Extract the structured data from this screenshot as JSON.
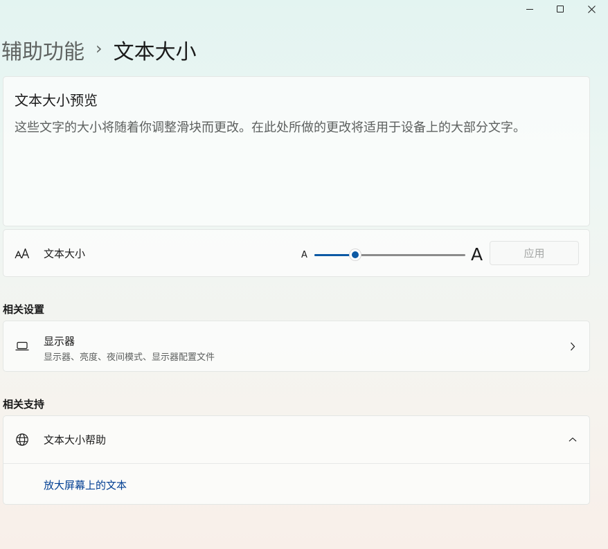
{
  "breadcrumb": {
    "parent": "辅助功能",
    "separator": "›",
    "current": "文本大小"
  },
  "preview": {
    "title": "文本大小预览",
    "body": "这些文字的大小将随着你调整滑块而更改。在此处所做的更改将适用于设备上的大部分文字。"
  },
  "text_size": {
    "icon": "text-size-icon",
    "label": "文本大小",
    "small_marker": "A",
    "large_marker": "A",
    "slider_fraction": 0.27,
    "apply_label": "应用",
    "accent_color": "#0c59a4"
  },
  "related_settings": {
    "heading": "相关设置",
    "display": {
      "icon": "laptop-icon",
      "title": "显示器",
      "subtitle": "显示器、亮度、夜间模式、显示器配置文件"
    }
  },
  "related_support": {
    "heading": "相关支持",
    "help": {
      "icon": "globe-icon",
      "title": "文本大小帮助",
      "expanded": true,
      "link_label": "放大屏幕上的文本",
      "link_color": "#003e92"
    }
  }
}
